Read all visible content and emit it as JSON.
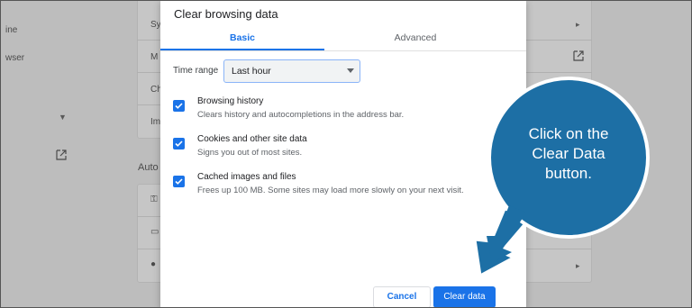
{
  "background": {
    "left_items": [
      "ine",
      "wser"
    ],
    "card_labels": [
      "Sy",
      "M",
      "Ch",
      "Im"
    ],
    "section_label": "Auto"
  },
  "dialog": {
    "title": "Clear browsing data",
    "tabs": [
      {
        "label": "Basic",
        "active": true
      },
      {
        "label": "Advanced",
        "active": false
      }
    ],
    "time_range": {
      "label": "Time range",
      "value": "Last hour"
    },
    "options": [
      {
        "title": "Browsing history",
        "description": "Clears history and autocompletions in the address bar.",
        "checked": true
      },
      {
        "title": "Cookies and other site data",
        "description": "Signs you out of most sites.",
        "checked": true
      },
      {
        "title": "Cached images and files",
        "description": "Frees up 100 MB. Some sites may load more slowly on your next visit.",
        "checked": true
      }
    ],
    "buttons": {
      "cancel": "Cancel",
      "clear": "Clear data"
    }
  },
  "callout": {
    "lines": [
      "Click on the",
      "Clear Data",
      "button."
    ]
  },
  "colors": {
    "accent": "#1a73e8",
    "callout_fill": "#1d6fa5",
    "callout_stroke": "#ffffff",
    "overlay": "#bdbdbd"
  },
  "icons": [
    "checkbox-checked-icon",
    "dropdown-caret-icon",
    "external-link-icon",
    "chevron-right-icon",
    "chevron-down-icon"
  ]
}
